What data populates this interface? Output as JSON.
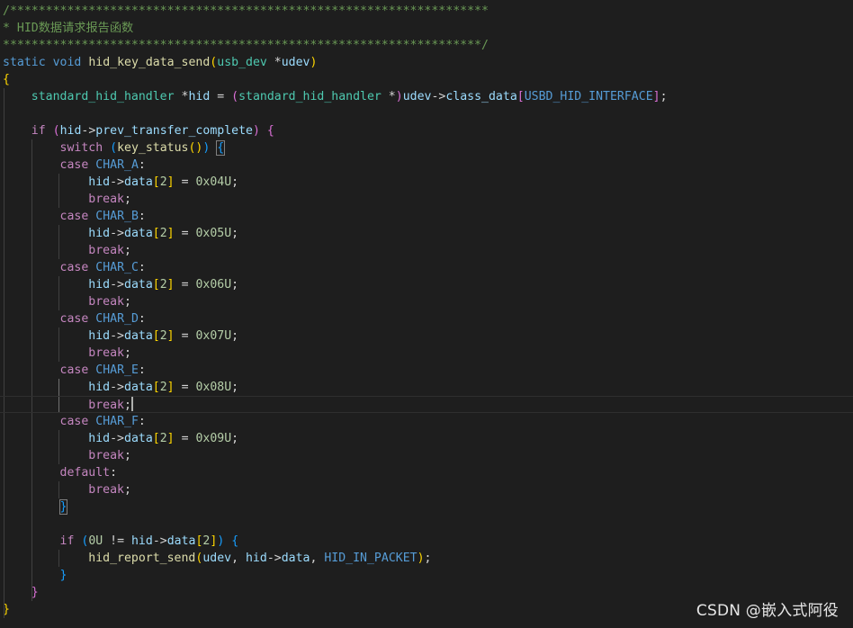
{
  "colors": {
    "comment": "#6a9955",
    "keyword": "#569cd6",
    "control": "#c586c0",
    "function": "#dcdcaa",
    "type": "#4ec9b0",
    "variable": "#9cdcfe",
    "macro": "#569cd6",
    "number": "#b5cea8",
    "brace1": "#ffd700",
    "brace2": "#da70d6",
    "brace3": "#179fff",
    "plain": "#d4d4d4"
  },
  "code_lines": [
    [
      [
        "comment",
        "/*******************************************************************"
      ]
    ],
    [
      [
        "comment",
        "* HID数据请求报告函数"
      ]
    ],
    [
      [
        "comment",
        "*******************************************************************/"
      ]
    ],
    [
      [
        "keyword",
        "static"
      ],
      [
        "plain",
        " "
      ],
      [
        "keyword",
        "void"
      ],
      [
        "plain",
        " "
      ],
      [
        "function",
        "hid_key_data_send"
      ],
      [
        "brace1",
        "("
      ],
      [
        "type",
        "usb_dev"
      ],
      [
        "plain",
        " *"
      ],
      [
        "variable",
        "udev"
      ],
      [
        "brace1",
        ")"
      ]
    ],
    [
      [
        "brace1",
        "{"
      ]
    ],
    [
      [
        "plain",
        "    "
      ],
      [
        "type",
        "standard_hid_handler"
      ],
      [
        "plain",
        " *"
      ],
      [
        "variable",
        "hid"
      ],
      [
        "plain",
        " = "
      ],
      [
        "brace2",
        "("
      ],
      [
        "type",
        "standard_hid_handler"
      ],
      [
        "plain",
        " *"
      ],
      [
        "brace2",
        ")"
      ],
      [
        "variable",
        "udev"
      ],
      [
        "plain",
        "->"
      ],
      [
        "variable",
        "class_data"
      ],
      [
        "brace2",
        "["
      ],
      [
        "macro",
        "USBD_HID_INTERFACE"
      ],
      [
        "brace2",
        "]"
      ],
      [
        "plain",
        ";"
      ]
    ],
    [
      [
        "plain",
        ""
      ]
    ],
    [
      [
        "plain",
        "    "
      ],
      [
        "control",
        "if"
      ],
      [
        "plain",
        " "
      ],
      [
        "brace2",
        "("
      ],
      [
        "variable",
        "hid"
      ],
      [
        "plain",
        "->"
      ],
      [
        "variable",
        "prev_transfer_complete"
      ],
      [
        "brace2",
        ")"
      ],
      [
        "plain",
        " "
      ],
      [
        "brace2",
        "{"
      ]
    ],
    [
      [
        "plain",
        "        "
      ],
      [
        "control",
        "switch"
      ],
      [
        "plain",
        " "
      ],
      [
        "brace3",
        "("
      ],
      [
        "function",
        "key_status"
      ],
      [
        "brace1",
        "()"
      ],
      [
        "brace3",
        ")"
      ],
      [
        "plain",
        " "
      ],
      [
        "brace3",
        "{",
        "bm"
      ]
    ],
    [
      [
        "plain",
        "        "
      ],
      [
        "control",
        "case"
      ],
      [
        "plain",
        " "
      ],
      [
        "macro",
        "CHAR_A"
      ],
      [
        "plain",
        ":"
      ]
    ],
    [
      [
        "plain",
        "            "
      ],
      [
        "variable",
        "hid"
      ],
      [
        "plain",
        "->"
      ],
      [
        "variable",
        "data"
      ],
      [
        "brace1",
        "["
      ],
      [
        "number",
        "2"
      ],
      [
        "brace1",
        "]"
      ],
      [
        "plain",
        " = "
      ],
      [
        "number",
        "0x04U"
      ],
      [
        "plain",
        ";"
      ]
    ],
    [
      [
        "plain",
        "            "
      ],
      [
        "control",
        "break"
      ],
      [
        "plain",
        ";"
      ]
    ],
    [
      [
        "plain",
        "        "
      ],
      [
        "control",
        "case"
      ],
      [
        "plain",
        " "
      ],
      [
        "macro",
        "CHAR_B"
      ],
      [
        "plain",
        ":"
      ]
    ],
    [
      [
        "plain",
        "            "
      ],
      [
        "variable",
        "hid"
      ],
      [
        "plain",
        "->"
      ],
      [
        "variable",
        "data"
      ],
      [
        "brace1",
        "["
      ],
      [
        "number",
        "2"
      ],
      [
        "brace1",
        "]"
      ],
      [
        "plain",
        " = "
      ],
      [
        "number",
        "0x05U"
      ],
      [
        "plain",
        ";"
      ]
    ],
    [
      [
        "plain",
        "            "
      ],
      [
        "control",
        "break"
      ],
      [
        "plain",
        ";"
      ]
    ],
    [
      [
        "plain",
        "        "
      ],
      [
        "control",
        "case"
      ],
      [
        "plain",
        " "
      ],
      [
        "macro",
        "CHAR_C"
      ],
      [
        "plain",
        ":"
      ]
    ],
    [
      [
        "plain",
        "            "
      ],
      [
        "variable",
        "hid"
      ],
      [
        "plain",
        "->"
      ],
      [
        "variable",
        "data"
      ],
      [
        "brace1",
        "["
      ],
      [
        "number",
        "2"
      ],
      [
        "brace1",
        "]"
      ],
      [
        "plain",
        " = "
      ],
      [
        "number",
        "0x06U"
      ],
      [
        "plain",
        ";"
      ]
    ],
    [
      [
        "plain",
        "            "
      ],
      [
        "control",
        "break"
      ],
      [
        "plain",
        ";"
      ]
    ],
    [
      [
        "plain",
        "        "
      ],
      [
        "control",
        "case"
      ],
      [
        "plain",
        " "
      ],
      [
        "macro",
        "CHAR_D"
      ],
      [
        "plain",
        ":"
      ]
    ],
    [
      [
        "plain",
        "            "
      ],
      [
        "variable",
        "hid"
      ],
      [
        "plain",
        "->"
      ],
      [
        "variable",
        "data"
      ],
      [
        "brace1",
        "["
      ],
      [
        "number",
        "2"
      ],
      [
        "brace1",
        "]"
      ],
      [
        "plain",
        " = "
      ],
      [
        "number",
        "0x07U"
      ],
      [
        "plain",
        ";"
      ]
    ],
    [
      [
        "plain",
        "            "
      ],
      [
        "control",
        "break"
      ],
      [
        "plain",
        ";"
      ]
    ],
    [
      [
        "plain",
        "        "
      ],
      [
        "control",
        "case"
      ],
      [
        "plain",
        " "
      ],
      [
        "macro",
        "CHAR_E"
      ],
      [
        "plain",
        ":"
      ]
    ],
    [
      [
        "plain",
        "            "
      ],
      [
        "variable",
        "hid"
      ],
      [
        "plain",
        "->"
      ],
      [
        "variable",
        "data"
      ],
      [
        "brace1",
        "["
      ],
      [
        "number",
        "2"
      ],
      [
        "brace1",
        "]"
      ],
      [
        "plain",
        " = "
      ],
      [
        "number",
        "0x08U"
      ],
      [
        "plain",
        ";"
      ]
    ],
    [
      [
        "plain",
        "            "
      ],
      [
        "control",
        "break"
      ],
      [
        "plain",
        ";"
      ]
    ],
    [
      [
        "plain",
        "        "
      ],
      [
        "control",
        "case"
      ],
      [
        "plain",
        " "
      ],
      [
        "macro",
        "CHAR_F"
      ],
      [
        "plain",
        ":"
      ]
    ],
    [
      [
        "plain",
        "            "
      ],
      [
        "variable",
        "hid"
      ],
      [
        "plain",
        "->"
      ],
      [
        "variable",
        "data"
      ],
      [
        "brace1",
        "["
      ],
      [
        "number",
        "2"
      ],
      [
        "brace1",
        "]"
      ],
      [
        "plain",
        " = "
      ],
      [
        "number",
        "0x09U"
      ],
      [
        "plain",
        ";"
      ]
    ],
    [
      [
        "plain",
        "            "
      ],
      [
        "control",
        "break"
      ],
      [
        "plain",
        ";"
      ]
    ],
    [
      [
        "plain",
        "        "
      ],
      [
        "control",
        "default"
      ],
      [
        "plain",
        ":"
      ]
    ],
    [
      [
        "plain",
        "            "
      ],
      [
        "control",
        "break"
      ],
      [
        "plain",
        ";"
      ]
    ],
    [
      [
        "plain",
        "        "
      ],
      [
        "brace3",
        "}",
        "bm"
      ]
    ],
    [
      [
        "plain",
        ""
      ]
    ],
    [
      [
        "plain",
        "        "
      ],
      [
        "control",
        "if"
      ],
      [
        "plain",
        " "
      ],
      [
        "brace3",
        "("
      ],
      [
        "number",
        "0U"
      ],
      [
        "plain",
        " != "
      ],
      [
        "variable",
        "hid"
      ],
      [
        "plain",
        "->"
      ],
      [
        "variable",
        "data"
      ],
      [
        "brace1",
        "["
      ],
      [
        "number",
        "2"
      ],
      [
        "brace1",
        "]"
      ],
      [
        "brace3",
        ")"
      ],
      [
        "plain",
        " "
      ],
      [
        "brace3",
        "{"
      ]
    ],
    [
      [
        "plain",
        "            "
      ],
      [
        "function",
        "hid_report_send"
      ],
      [
        "brace1",
        "("
      ],
      [
        "variable",
        "udev"
      ],
      [
        "plain",
        ", "
      ],
      [
        "variable",
        "hid"
      ],
      [
        "plain",
        "->"
      ],
      [
        "variable",
        "data"
      ],
      [
        "plain",
        ", "
      ],
      [
        "macro",
        "HID_IN_PACKET"
      ],
      [
        "brace1",
        ")"
      ],
      [
        "plain",
        ";"
      ]
    ],
    [
      [
        "plain",
        "        "
      ],
      [
        "brace3",
        "}"
      ]
    ],
    [
      [
        "plain",
        "    "
      ],
      [
        "brace2",
        "}"
      ]
    ],
    [
      [
        "brace1",
        "}"
      ]
    ]
  ],
  "editor": {
    "current_line": 23,
    "cursor_line": 23
  },
  "watermark": {
    "text": "CSDN @嵌入式阿役"
  }
}
